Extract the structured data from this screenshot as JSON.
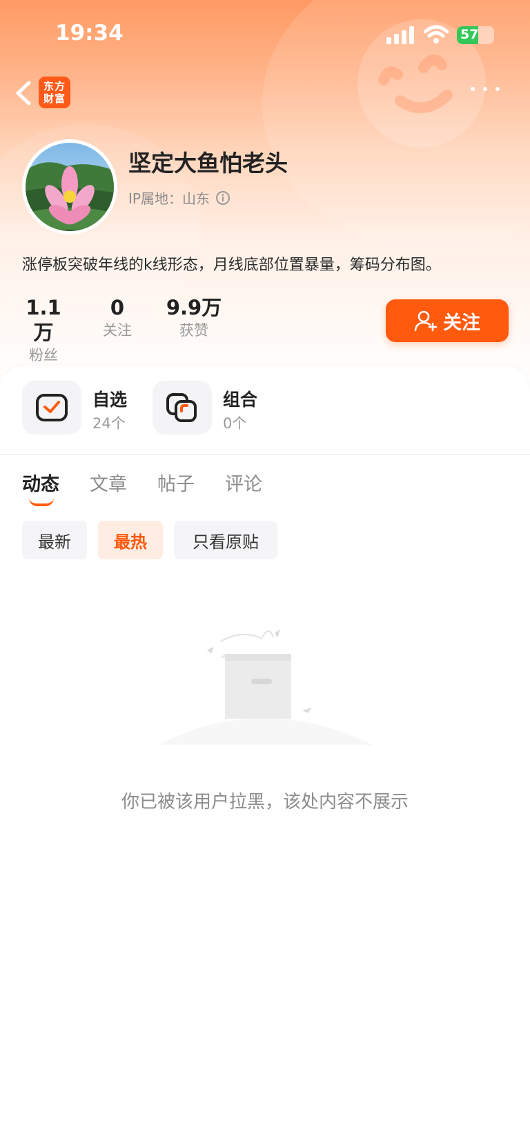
{
  "status_bar": {
    "time": "19:34",
    "battery_level": "57",
    "battery_color": "#34c759"
  },
  "nav": {
    "app_logo_line1": "东方",
    "app_logo_line2": "财富",
    "back_icon": "chevron-left-icon",
    "more_icon": "ellipsis-icon"
  },
  "profile": {
    "username": "坚定大鱼怕老头",
    "ip_location": "IP属地：山东",
    "bio": "涨停板突破年线的k线形态，月线底部位置暴量，筹码分布图。",
    "stats": [
      {
        "value": "1.1万",
        "label": "粉丝"
      },
      {
        "value": "0",
        "label": "关注"
      },
      {
        "value": "9.9万",
        "label": "获赞"
      }
    ],
    "follow_label": "关注",
    "accent_color": "#ff5a0e"
  },
  "shortcuts": [
    {
      "name": "自选",
      "count": "24个",
      "icon": "watchlist-check-icon"
    },
    {
      "name": "组合",
      "count": "0个",
      "icon": "portfolio-icon"
    }
  ],
  "tabs": [
    {
      "label": "动态",
      "active": true
    },
    {
      "label": "文章",
      "active": false
    },
    {
      "label": "帖子",
      "active": false
    },
    {
      "label": "评论",
      "active": false
    }
  ],
  "filters": [
    {
      "label": "最新",
      "active": false
    },
    {
      "label": "最热",
      "active": true
    },
    {
      "label": "只看原贴",
      "active": false
    }
  ],
  "empty_state": {
    "message": "你已被该用户拉黑，该处内容不展示",
    "icon": "empty-box-icon"
  }
}
